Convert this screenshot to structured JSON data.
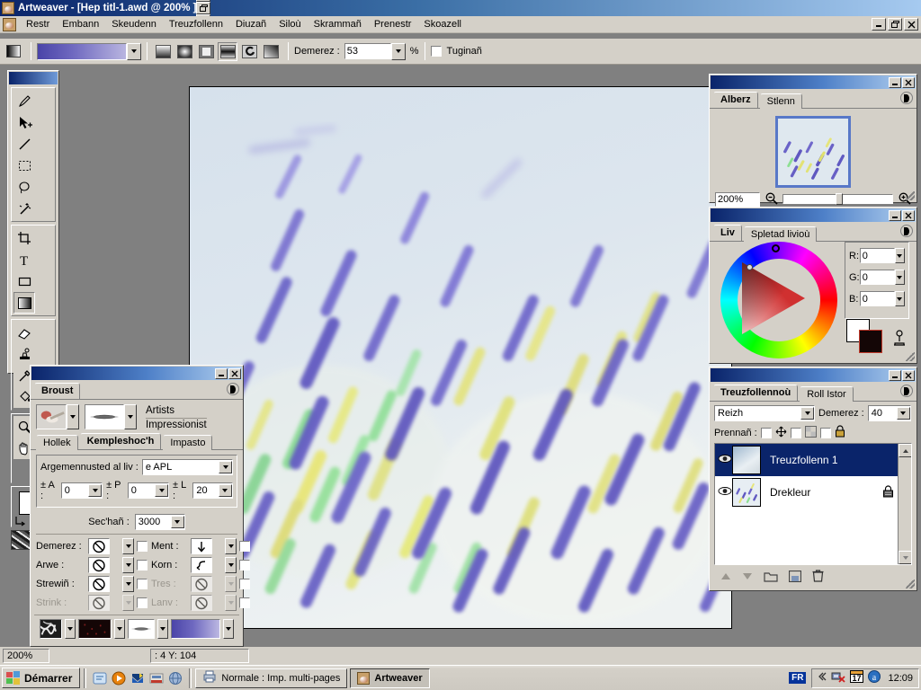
{
  "app": {
    "title": "Artweaver - [Hep titl-1.awd @ 200% ]",
    "icon": "artweaver-icon"
  },
  "menubar": {
    "items": [
      {
        "label": "Restr"
      },
      {
        "label": "Embann"
      },
      {
        "label": "Skeudenn"
      },
      {
        "label": "Treuzfollenn"
      },
      {
        "label": "Diuzañ"
      },
      {
        "label": "Siloù"
      },
      {
        "label": "Skrammañ"
      },
      {
        "label": "Prenestr"
      },
      {
        "label": "Skoazell"
      }
    ]
  },
  "window_buttons": {
    "minimize": "_",
    "restore": "❐",
    "close": "✕"
  },
  "toolbar": {
    "gradient_swatch": "gradient-preview",
    "gradient_colors": [
      "#4a44a8",
      "#b9b5e0"
    ],
    "mode_buttons": [
      "linear-gradient-icon",
      "radial-gradient-icon",
      "square-gradient-icon",
      "reflected-gradient-icon",
      "spiral-gradient-icon",
      "angle-gradient-icon"
    ],
    "opacity_label": "Demerez :",
    "opacity_value": "53",
    "percent_sign": "%",
    "reverse_label": "Tuginañ",
    "reverse_checked": false
  },
  "tools": {
    "items": [
      {
        "name": "brush-tool",
        "glyph": "brush"
      },
      {
        "name": "move-tool",
        "glyph": "move"
      },
      {
        "name": "line-tool",
        "glyph": "line"
      },
      {
        "name": "rect-select-tool",
        "glyph": "marquee"
      },
      {
        "name": "lasso-tool",
        "glyph": "lasso"
      },
      {
        "name": "magic-wand-tool",
        "glyph": "wand"
      },
      {
        "name": "crop-tool",
        "glyph": "crop"
      },
      {
        "name": "text-tool",
        "glyph": "text"
      },
      {
        "name": "shape-tool",
        "glyph": "rect"
      },
      {
        "name": "gradient-tool",
        "glyph": "gradient"
      },
      {
        "name": "eraser-tool",
        "glyph": "eraser"
      },
      {
        "name": "clone-stamp-tool",
        "glyph": "stamp"
      },
      {
        "name": "eyedropper-tool",
        "glyph": "dropper"
      },
      {
        "name": "paint-bucket-tool",
        "glyph": "bucket"
      },
      {
        "name": "zoom-tool",
        "glyph": "magnifier"
      },
      {
        "name": "hand-tool",
        "glyph": "hand"
      },
      {
        "name": "perspective-tool",
        "glyph": "grid"
      }
    ],
    "active": "gradient-tool",
    "foreground_color": "#ffffff",
    "background_color": "#140606"
  },
  "navigator": {
    "tabs": [
      {
        "label": "Alberz",
        "active": true
      },
      {
        "label": "Stlenn",
        "active": false
      }
    ],
    "zoom_value": "200%",
    "zoom_out_icon": "zoom-out-icon",
    "zoom_in_icon": "zoom-in-icon"
  },
  "color_panel": {
    "tabs": [
      {
        "label": "Liv",
        "active": true
      },
      {
        "label": "Spletad livioù",
        "active": false
      }
    ],
    "channels": [
      {
        "label": "R:",
        "value": "0"
      },
      {
        "label": "G:",
        "value": "0"
      },
      {
        "label": "B:",
        "value": "0"
      }
    ],
    "swatch_fg": "#ffffff",
    "swatch_bg": "#140606",
    "picker_icon": "color-picker-icon"
  },
  "layers_panel": {
    "tabs": [
      {
        "label": "Treuzfollennoù",
        "active": true
      },
      {
        "label": "Roll Istor",
        "active": false
      }
    ],
    "blend_mode": "Reizh",
    "opacity_label": "Demerez :",
    "opacity_value": "40",
    "lock_label": "Prennañ :",
    "lock_toggles": [
      {
        "name": "lock-move-icon",
        "checked": false
      },
      {
        "name": "lock-transparency-icon",
        "checked": false
      },
      {
        "name": "lock-all-icon",
        "checked": false
      }
    ],
    "layers": [
      {
        "name": "Treuzfollenn 1",
        "visible": true,
        "selected": true,
        "locked": false
      },
      {
        "name": "Drekleur",
        "visible": true,
        "selected": false,
        "locked": true
      }
    ],
    "buttons": [
      {
        "name": "move-layer-up-button",
        "glyph": "▲"
      },
      {
        "name": "move-layer-down-button",
        "glyph": "▼"
      },
      {
        "name": "new-group-button",
        "glyph": "folder"
      },
      {
        "name": "new-layer-button",
        "glyph": "new-layer"
      },
      {
        "name": "delete-layer-button",
        "glyph": "trash"
      }
    ]
  },
  "brush_panel": {
    "title": "Broust",
    "tab_label": "Broust",
    "category": "Artists",
    "variant": "Impressionist",
    "tabs": [
      {
        "label": "Hollek",
        "active": false
      },
      {
        "label": "Kempleshoc'h",
        "active": true
      },
      {
        "label": "Impasto",
        "active": false
      }
    ],
    "color_source_label": "Argemennusted al liv :",
    "color_source_value": "e APL",
    "jitter": [
      {
        "label": "± A :",
        "value": "0"
      },
      {
        "label": "± P :",
        "value": "0"
      },
      {
        "label": "± L :",
        "value": "20"
      }
    ],
    "dry_label": "Sec'hañ :",
    "dry_value": "3000",
    "controls": [
      {
        "label": "Demerez :",
        "icon": "none-icon",
        "dim": false,
        "checked": false
      },
      {
        "label": "Ment :",
        "icon": "down-arrow-icon",
        "dim": false,
        "checked": false
      },
      {
        "label": "Arwe :",
        "icon": "none-icon",
        "dim": false,
        "checked": false
      },
      {
        "label": "Korn :",
        "icon": "s-curve-icon",
        "dim": false,
        "checked": false
      },
      {
        "label": "Strewiñ :",
        "icon": "none-icon",
        "dim": false,
        "checked": false
      },
      {
        "label": "Tres :",
        "icon": "none-icon",
        "dim": true,
        "checked": false
      },
      {
        "label": "Strink :",
        "icon": "none-icon",
        "dim": true,
        "checked": false
      },
      {
        "label": "Lanv :",
        "icon": "none-icon",
        "dim": true,
        "checked": false
      }
    ],
    "bottom_wells": [
      {
        "name": "paper-texture-well"
      },
      {
        "name": "pattern-well"
      },
      {
        "name": "brush-tip-well"
      },
      {
        "name": "gradient-well"
      }
    ]
  },
  "statusbar": {
    "zoom": "200%",
    "coords": ": 4  Y: 104"
  },
  "taskbar": {
    "start_label": "Démarrer",
    "quicklaunch": [
      {
        "name": "show-desktop-icon"
      },
      {
        "name": "media-player-icon"
      },
      {
        "name": "outlook-icon"
      },
      {
        "name": "app-icon-red"
      },
      {
        "name": "browser-icon"
      }
    ],
    "tasks": [
      {
        "label": "Normale : Imp. multi-pages",
        "active": false,
        "icon": "printer-icon"
      },
      {
        "label": "Artweaver",
        "active": true,
        "icon": "artweaver-icon"
      }
    ],
    "language": "FR",
    "tray_icons": [
      {
        "name": "show-hidden-icons-chevron"
      },
      {
        "name": "network-disconnected-icon"
      },
      {
        "name": "calendar-17-icon"
      },
      {
        "name": "antivirus-icon"
      }
    ],
    "clock": "12:09"
  }
}
